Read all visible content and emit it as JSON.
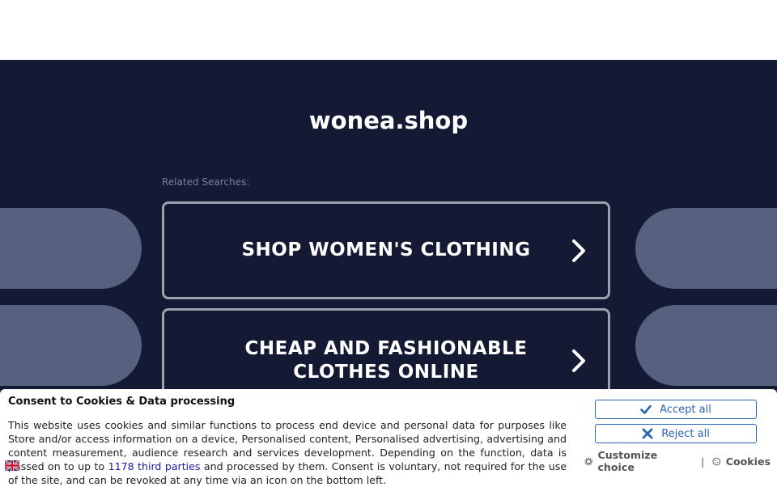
{
  "page": {
    "domain": "wonea.shop",
    "related_label": "Related Searches:"
  },
  "searches": [
    {
      "label": "SHOP WOMEN'S CLOTHING"
    },
    {
      "label": "CHEAP AND FASHIONABLE CLOTHES ONLINE"
    }
  ],
  "consent": {
    "title": "Consent to Cookies & Data processing",
    "text_before_link": "This website uses cookies and similar functions to process end device and personal data for purposes like Store and/or access information on a device, Personalised content, Personalised advertising, advertising and content measurement, audience research and services development. Depending on the function, data is passed on to up to ",
    "link_text": "1178 third parties",
    "text_after_link": " and processed by them. Consent is voluntary, not required for the use of the site, and can be revoked at any time via an icon on the bottom left.",
    "accept_label": "Accept all",
    "reject_label": "Reject all",
    "customize_label": "Customize choice",
    "separator": "|",
    "cookies_label": "Cookies"
  },
  "colors": {
    "background_dark": "#141a33",
    "pill": "#56607f",
    "button_border": "#9ea1ab",
    "consent_blue": "#2a64b3"
  }
}
